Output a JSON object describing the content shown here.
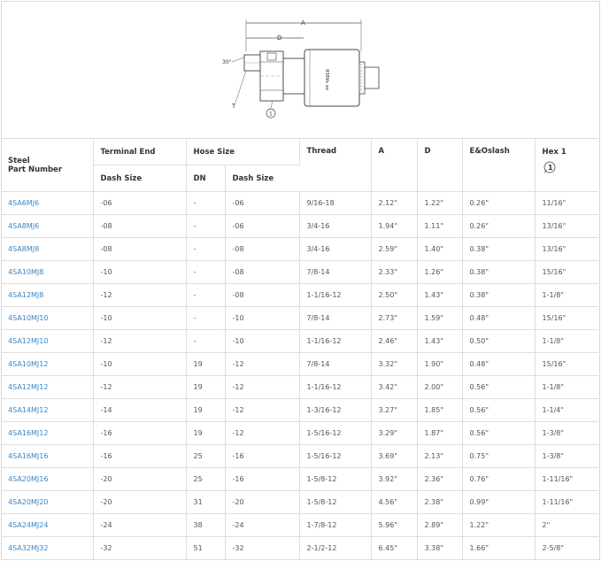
{
  "drawing": {
    "labels": {
      "a": "A",
      "d": "D",
      "angle": "30°",
      "t": "T",
      "hex_marker": "1"
    },
    "body_text": "ЯƎ8Ɐκ ǝǝ"
  },
  "table": {
    "headers": {
      "steel_part": "Steel",
      "steel_part_2": "Part Number",
      "terminal_end": "Terminal End",
      "hose_size": "Hose Size",
      "thread": "Thread",
      "a": "A",
      "d": "D",
      "e_oslash": "E&Oslash",
      "hex1": "Hex 1",
      "hex_marker": "1",
      "dash_size": "Dash Size",
      "dn": "DN",
      "hose_dash_size": "Dash Size"
    },
    "rows": [
      [
        "4SA6MJ6",
        "-06",
        "-",
        "-06",
        "9/16-18",
        "2.12\"",
        "1.22\"",
        "0.26\"",
        "11/16\""
      ],
      [
        "4SA8MJ6",
        "-08",
        "-",
        "-06",
        "3/4-16",
        "1.94\"",
        "1.11\"",
        "0.26\"",
        "13/16\""
      ],
      [
        "4SA8MJ8",
        "-08",
        "-",
        "-08",
        "3/4-16",
        "2.59\"",
        "1.40\"",
        "0.38\"",
        "13/16\""
      ],
      [
        "4SA10MJ8",
        "-10",
        "-",
        "-08",
        "7/8-14",
        "2.33\"",
        "1.26\"",
        "0.38\"",
        "15/16\""
      ],
      [
        "4SA12MJ8",
        "-12",
        "-",
        "-08",
        "1-1/16-12",
        "2.50\"",
        "1.43\"",
        "0.38\"",
        "1-1/8\""
      ],
      [
        "4SA10MJ10",
        "-10",
        "-",
        "-10",
        "7/8-14",
        "2.73\"",
        "1.59\"",
        "0.48\"",
        "15/16\""
      ],
      [
        "4SA12MJ10",
        "-12",
        "-",
        "-10",
        "1-1/16-12",
        "2.46\"",
        "1.43\"",
        "0.50\"",
        "1-1/8\""
      ],
      [
        "4SA10MJ12",
        "-10",
        "19",
        "-12",
        "7/8-14",
        "3.32\"",
        "1.90\"",
        "0.48\"",
        "15/16\""
      ],
      [
        "4SA12MJ12",
        "-12",
        "19",
        "-12",
        "1-1/16-12",
        "3.42\"",
        "2.00\"",
        "0.56\"",
        "1-1/8\""
      ],
      [
        "4SA14MJ12",
        "-14",
        "19",
        "-12",
        "1-3/16-12",
        "3.27\"",
        "1.85\"",
        "0.56\"",
        "1-1/4\""
      ],
      [
        "4SA16MJ12",
        "-16",
        "19",
        "-12",
        "1-5/16-12",
        "3.29\"",
        "1.87\"",
        "0.56\"",
        "1-3/8\""
      ],
      [
        "4SA16MJ16",
        "-16",
        "25",
        "-16",
        "1-5/16-12",
        "3.69\"",
        "2.13\"",
        "0.75\"",
        "1-3/8\""
      ],
      [
        "4SA20MJ16",
        "-20",
        "25",
        "-16",
        "1-5/8-12",
        "3.92\"",
        "2.36\"",
        "0.76\"",
        "1-11/16\""
      ],
      [
        "4SA20MJ20",
        "-20",
        "31",
        "-20",
        "1-5/8-12",
        "4.56\"",
        "2.38\"",
        "0.99\"",
        "1-11/16\""
      ],
      [
        "4SA24MJ24",
        "-24",
        "38",
        "-24",
        "1-7/8-12",
        "5.96\"",
        "2.89\"",
        "1.22\"",
        "2\""
      ],
      [
        "4SA32MJ32",
        "-32",
        "51",
        "-32",
        "2-1/2-12",
        "6.45\"",
        "3.38\"",
        "1.66\"",
        "2-5/8\""
      ]
    ]
  }
}
